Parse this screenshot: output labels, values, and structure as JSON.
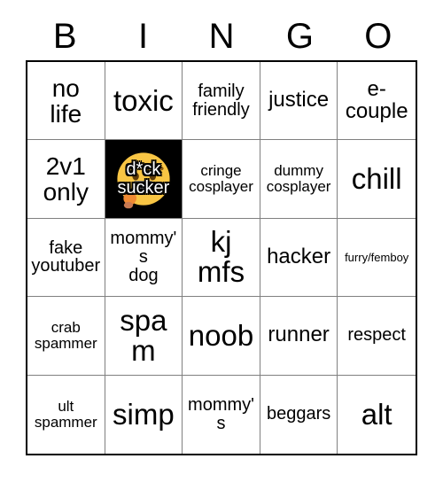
{
  "card": {
    "title": "BINGO",
    "header_letters": [
      "B",
      "I",
      "N",
      "G",
      "O"
    ],
    "grid_border_color": "#000000",
    "cell_border_color": "#808080",
    "marked_cell_background": "#000000",
    "marked_cell_text_color": "#ffffff",
    "emoji_face_color": "#F8C544",
    "emoji_accent_color": "#F08A33",
    "emoji_metal_color": "#9AA0A6"
  },
  "columns": [
    {
      "letter": "B"
    },
    {
      "letter": "I"
    },
    {
      "letter": "N"
    },
    {
      "letter": "G"
    },
    {
      "letter": "O"
    }
  ],
  "cells": [
    {
      "text": "no\nlife",
      "size": "xl",
      "marked": false,
      "icon": ""
    },
    {
      "text": "toxic",
      "size": "xxl",
      "marked": false,
      "icon": ""
    },
    {
      "text": "family\nfriendly",
      "size": "md",
      "marked": false,
      "icon": ""
    },
    {
      "text": "justice",
      "size": "lg",
      "marked": false,
      "icon": ""
    },
    {
      "text": "e-\ncouple",
      "size": "lg",
      "marked": false,
      "icon": ""
    },
    {
      "text": "2v1\nonly",
      "size": "xl",
      "marked": false,
      "icon": ""
    },
    {
      "text": "d*ck\nsucker",
      "size": "md",
      "marked": true,
      "icon": "zipper-face-emoji"
    },
    {
      "text": "cringe\ncosplayer",
      "size": "sm",
      "marked": false,
      "icon": ""
    },
    {
      "text": "dummy\ncosplayer",
      "size": "sm",
      "marked": false,
      "icon": ""
    },
    {
      "text": "chill",
      "size": "xxl",
      "marked": false,
      "icon": ""
    },
    {
      "text": "fake\nyoutuber",
      "size": "md",
      "marked": false,
      "icon": ""
    },
    {
      "text": "mommy's\ndog",
      "size": "md",
      "marked": false,
      "icon": ""
    },
    {
      "text": "kj\nmfs",
      "size": "xxl",
      "marked": false,
      "icon": ""
    },
    {
      "text": "hacker",
      "size": "lg",
      "marked": false,
      "icon": ""
    },
    {
      "text": "furry/femboy",
      "size": "xs",
      "marked": false,
      "icon": ""
    },
    {
      "text": "crab\nspammer",
      "size": "sm",
      "marked": false,
      "icon": ""
    },
    {
      "text": "spam",
      "size": "xxl",
      "marked": false,
      "icon": ""
    },
    {
      "text": "noob",
      "size": "xxl",
      "marked": false,
      "icon": ""
    },
    {
      "text": "runner",
      "size": "lg",
      "marked": false,
      "icon": ""
    },
    {
      "text": "respect",
      "size": "md",
      "marked": false,
      "icon": ""
    },
    {
      "text": "ult\nspammer",
      "size": "sm",
      "marked": false,
      "icon": ""
    },
    {
      "text": "simp",
      "size": "xxl",
      "marked": false,
      "icon": ""
    },
    {
      "text": "mommy's",
      "size": "md",
      "marked": false,
      "icon": ""
    },
    {
      "text": "beggars",
      "size": "md",
      "marked": false,
      "icon": ""
    },
    {
      "text": "alt",
      "size": "xxl",
      "marked": false,
      "icon": ""
    }
  ]
}
